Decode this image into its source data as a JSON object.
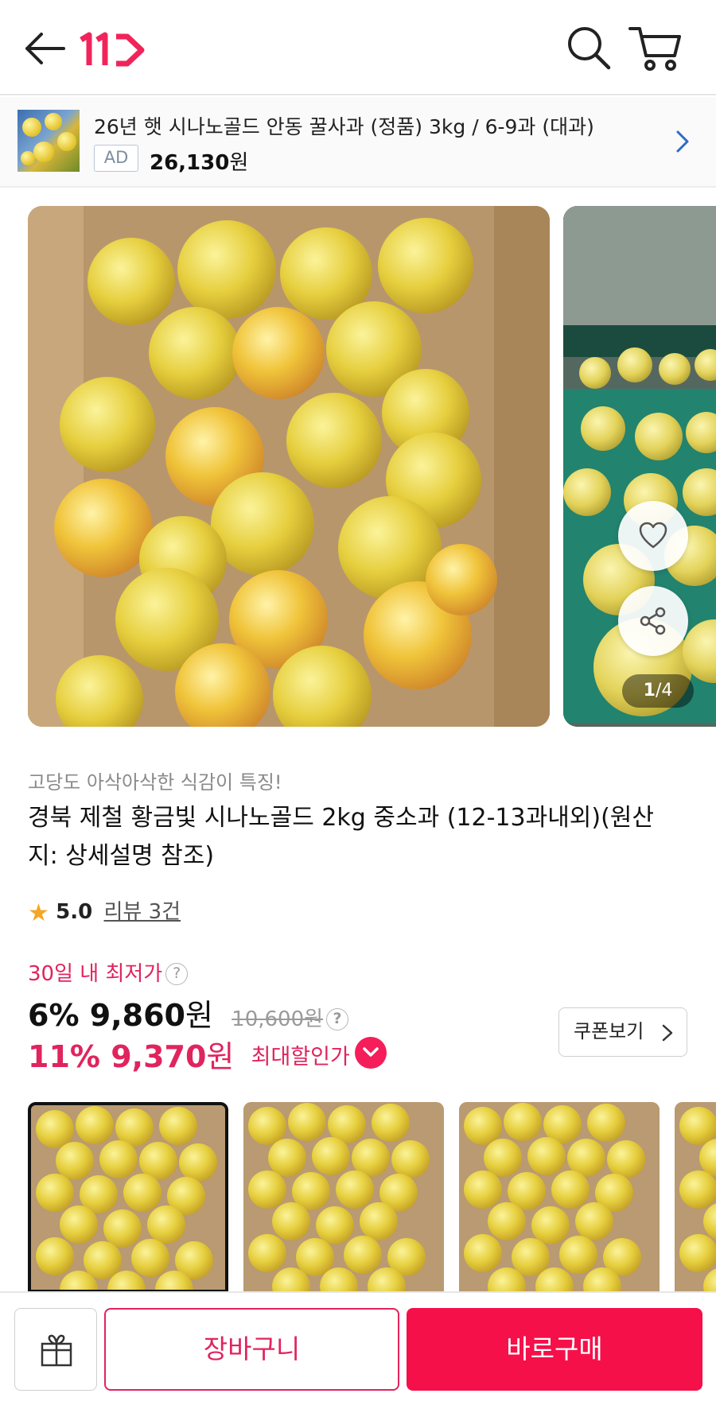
{
  "header": {
    "logo_text": "11",
    "back_icon": "arrow-left-icon",
    "search_icon": "search-icon",
    "cart_icon": "cart-icon",
    "brand_color": "#e0245e"
  },
  "ad_banner": {
    "title": "26년 햇 시나노골드 안동 꿀사과 (정품) 3kg / 6-9과 (대과)",
    "badge": "AD",
    "price_number": "26,130",
    "price_unit": "원"
  },
  "gallery": {
    "counter_current": "1",
    "counter_total": "/4"
  },
  "product": {
    "tagline": "고당도 아삭아삭한 식감이 특징!",
    "title": "경북 제철 황금빛 시나노골드 2kg 중소과 (12-13과내외)(원산지: 상세설명 참조)",
    "rating_score": "5.0",
    "review_text": "리뷰 3건"
  },
  "pricing": {
    "lowest_label": "30일 내 최저가",
    "help_glyph": "?",
    "discount1": "6%",
    "price1": "9,860",
    "won": "원",
    "original_price": "10,600원",
    "discount2": "11%",
    "price2": "9,370",
    "max_discount_label": "최대할인가",
    "coupon_button": "쿠폰보기",
    "accent_color": "#e0245e"
  },
  "bottom_bar": {
    "gift_icon": "gift-icon",
    "cart_button": "장바구니",
    "buy_button": "바로구매",
    "buy_color": "#f5104a"
  }
}
